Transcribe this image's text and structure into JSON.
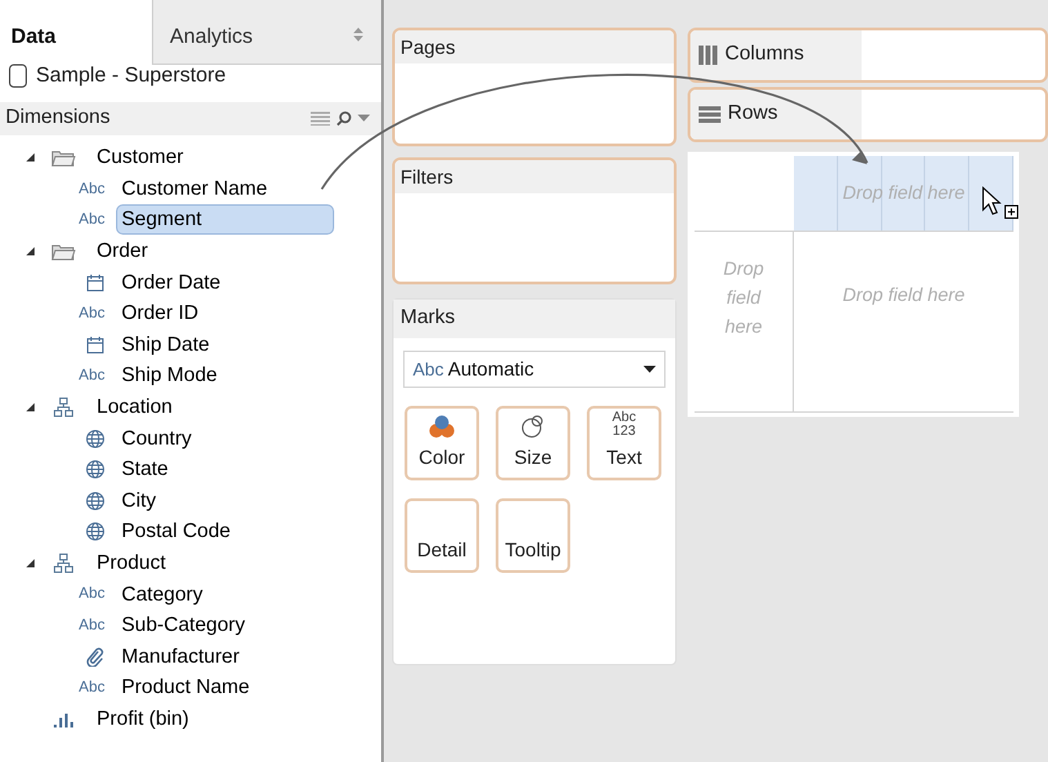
{
  "tabs": [
    {
      "label": "Data",
      "selected": true
    },
    {
      "label": "Analytics",
      "selected": false
    }
  ],
  "data_source": "Sample - Superstore",
  "dimensions": {
    "title": "Dimensions",
    "items": [
      {
        "kind": "folder",
        "label": "Customer",
        "expanded": true,
        "selected": false,
        "children": [
          {
            "kind": "abc",
            "icon_text": "Abc",
            "label": "Customer Name",
            "selected": false
          },
          {
            "kind": "abc",
            "icon_text": "Abc",
            "label": "Segment",
            "selected": true
          }
        ]
      },
      {
        "kind": "folder",
        "label": "Order",
        "expanded": true,
        "selected": false,
        "children": [
          {
            "kind": "date",
            "label": "Order Date",
            "selected": false
          },
          {
            "kind": "abc",
            "icon_text": "Abc",
            "label": "Order ID",
            "selected": false
          },
          {
            "kind": "date",
            "label": "Ship Date",
            "selected": false
          },
          {
            "kind": "abc",
            "icon_text": "Abc",
            "label": "Ship Mode",
            "selected": false
          }
        ]
      },
      {
        "kind": "hierarchy",
        "label": "Location",
        "expanded": true,
        "selected": false,
        "children": [
          {
            "kind": "globe",
            "label": "Country",
            "selected": false
          },
          {
            "kind": "globe",
            "label": "State",
            "selected": false
          },
          {
            "kind": "globe",
            "label": "City",
            "selected": false
          },
          {
            "kind": "globe",
            "label": "Postal Code",
            "selected": false
          }
        ]
      },
      {
        "kind": "hierarchy",
        "label": "Product",
        "expanded": true,
        "selected": false,
        "children": [
          {
            "kind": "abc",
            "icon_text": "Abc",
            "label": "Category",
            "selected": false
          },
          {
            "kind": "abc",
            "icon_text": "Abc",
            "label": "Sub-Category",
            "selected": false
          },
          {
            "kind": "clip",
            "label": "Manufacturer",
            "selected": false
          },
          {
            "kind": "abc",
            "icon_text": "Abc",
            "label": "Product Name",
            "selected": false
          }
        ]
      },
      {
        "kind": "bin",
        "label": "Profit (bin)",
        "selected": false
      }
    ]
  },
  "shelves": {
    "pages": "Pages",
    "filters": "Filters",
    "columns": "Columns",
    "rows": "Rows"
  },
  "marks": {
    "title": "Marks",
    "mark_type_icon": "Abc",
    "mark_type": "Automatic",
    "cards": [
      {
        "kind": "color",
        "label": "Color"
      },
      {
        "kind": "size",
        "label": "Size"
      },
      {
        "kind": "text",
        "label": "Text",
        "icon_text": "Abc 123"
      },
      {
        "kind": "plain",
        "label": "Detail"
      },
      {
        "kind": "plain",
        "label": "Tooltip"
      }
    ]
  },
  "view": {
    "top_drop": "Drop field here",
    "left_drop": "Drop field here",
    "center_drop": "Drop field here",
    "top_highlighted": true
  }
}
